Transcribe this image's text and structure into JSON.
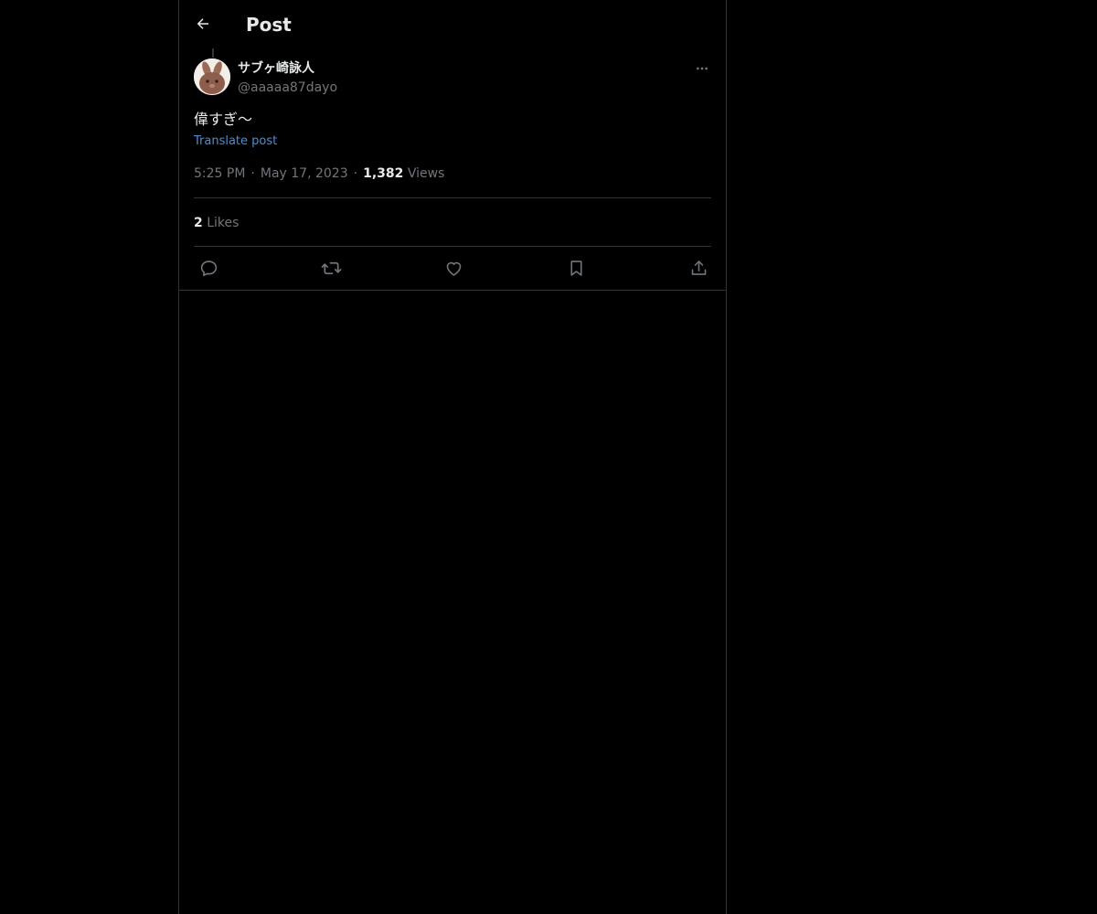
{
  "header": {
    "title": "Post"
  },
  "post": {
    "author_name": "サブヶ崎詠人",
    "author_handle": "@aaaaa87dayo",
    "text": "偉すぎ〜",
    "translate_label": "Translate post",
    "time": "5:25 PM",
    "separator": "·",
    "date": "May 17, 2023",
    "views_count": "1,382",
    "views_label": "Views",
    "likes_count": "2",
    "likes_label": "Likes"
  },
  "icons": {
    "back": "arrow-left-icon",
    "more": "more-horizontal-icon",
    "reply": "reply-icon",
    "repost": "repost-icon",
    "like": "heart-icon",
    "bookmark": "bookmark-icon",
    "share": "share-icon"
  },
  "colors": {
    "background": "#000000",
    "text_primary": "#e7e9ea",
    "text_secondary": "#71767b",
    "link": "#4a8fd6",
    "border": "#2f3336"
  }
}
